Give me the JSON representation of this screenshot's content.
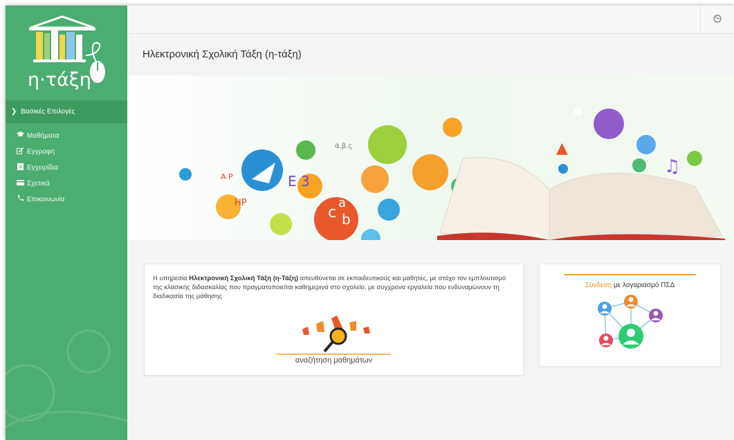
{
  "app": {
    "logo_text": "η·τάξη",
    "page_title": "Ηλεκτρονική Σχολική Τάξη (η-τάξη)"
  },
  "sidebar": {
    "section_label": "Βασικές Επιλογές",
    "items": [
      {
        "label": "Μαθήματα",
        "icon": "graduation-cap-icon"
      },
      {
        "label": "Εγγραφή",
        "icon": "edit-icon"
      },
      {
        "label": "Εγχειρίδια",
        "icon": "file-icon"
      },
      {
        "label": "Σχετικά",
        "icon": "credit-card-icon"
      },
      {
        "label": "Επικοινωνία",
        "icon": "phone-icon"
      }
    ]
  },
  "intro": {
    "text_prefix": "Η υπηρεσία ",
    "text_bold": "Ηλεκτρονική Σχολική Τάξη (η-Τάξη)",
    "text_suffix": " απευθύνεται σε εκπαιδευτικούς και μαθητές, με στόχο τον εμπλουτισμό της κλασικής διδασκαλίας που πραγματοποιείται καθημερινά στο σχολείο, με σύγχρονα εργαλεία που ενδυναμώνουν τη διαδικασία της μάθησης",
    "search_label": "αναζήτηση μαθημάτων"
  },
  "login": {
    "accent_text": "Σύνδεση",
    "rest_text": " με λογαριασμό ΠΣΔ"
  },
  "colors": {
    "sidebar": "#4cad72",
    "sidebar_header": "#3d9b62",
    "accent_orange": "#e8901b"
  }
}
